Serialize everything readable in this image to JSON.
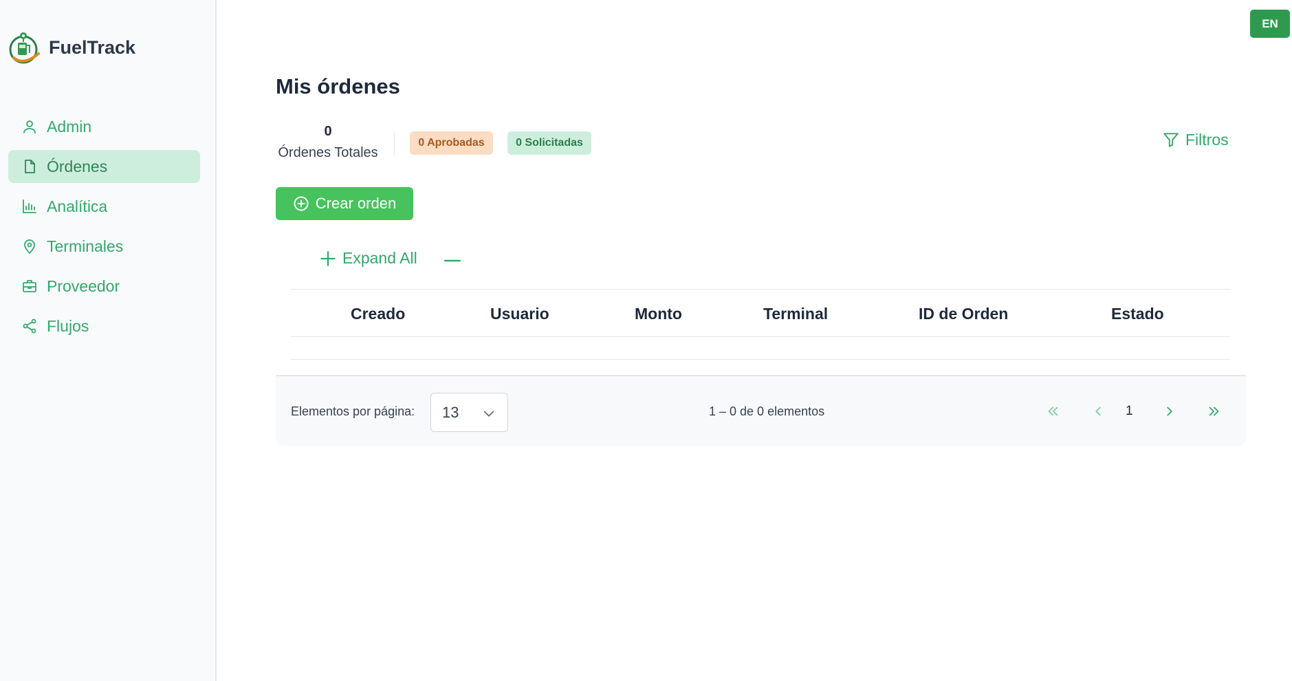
{
  "app": {
    "name": "FuelTrack"
  },
  "language": {
    "label": "EN"
  },
  "sidebar": {
    "items": [
      {
        "label": "Admin",
        "icon": "user-icon",
        "active": false
      },
      {
        "label": "Órdenes",
        "icon": "document-icon",
        "active": true
      },
      {
        "label": "Analítica",
        "icon": "bar-chart-icon",
        "active": false
      },
      {
        "label": "Terminales",
        "icon": "location-pin-icon",
        "active": false
      },
      {
        "label": "Proveedor",
        "icon": "briefcase-icon",
        "active": false
      },
      {
        "label": "Flujos",
        "icon": "share-nodes-icon",
        "active": false
      }
    ]
  },
  "main": {
    "title": "Mis órdenes",
    "stats": {
      "total_value": "0",
      "total_label": "Órdenes Totales",
      "approved": "0 Aprobadas",
      "requested": "0 Solicitadas"
    },
    "filters_label": "Filtros",
    "create_label": "Crear orden",
    "expand_all_label": "Expand All",
    "table": {
      "columns": [
        "Creado",
        "Usuario",
        "Monto",
        "Terminal",
        "ID de Orden",
        "Estado"
      ],
      "rows": []
    },
    "paginator": {
      "items_per_page_label": "Elementos por página:",
      "items_per_page_value": "13",
      "range_label": "1 – 0 de 0 elementos",
      "current_page": "1"
    }
  },
  "colors": {
    "accent": "#34a86b",
    "primary_button": "#47c35d",
    "active_nav_bg": "#cdeedd",
    "approved_bg": "#fbdcc4",
    "requested_bg": "#cdeedd"
  }
}
